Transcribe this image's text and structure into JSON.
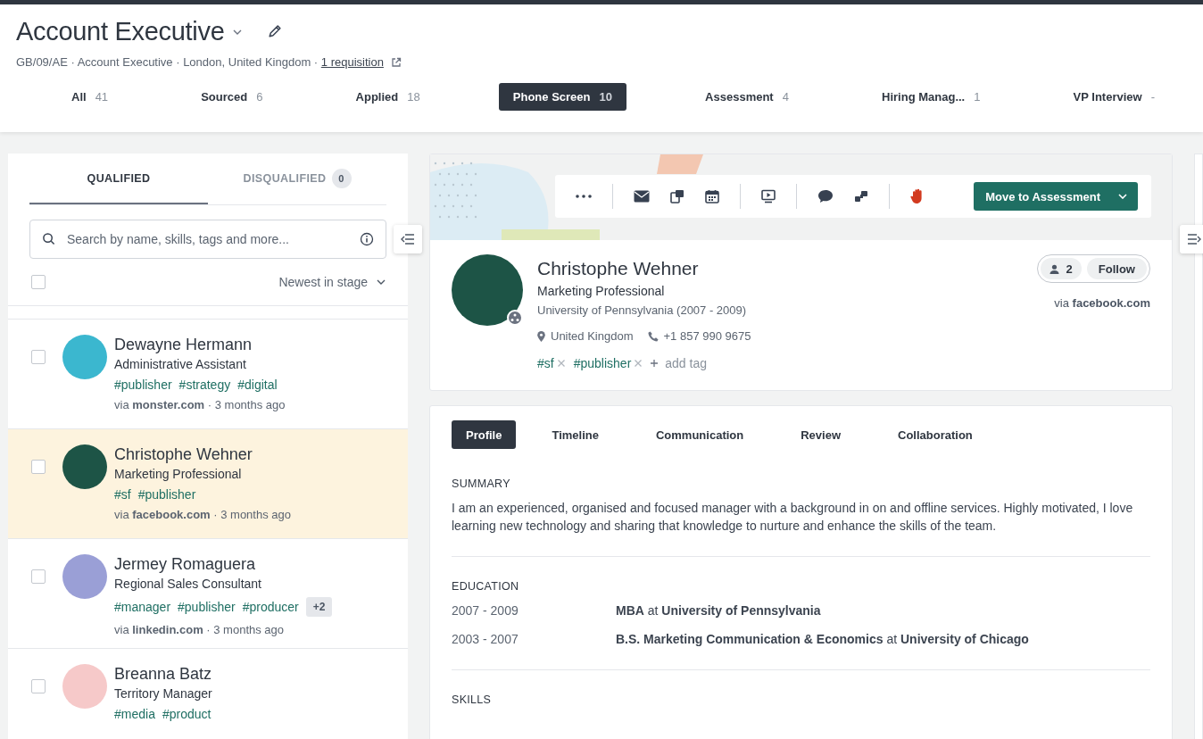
{
  "job": {
    "title": "Account Executive",
    "meta": "GB/09/AE · Account Executive · London, United Kingdom ·",
    "requisition_link": "1 requisition"
  },
  "stages": [
    {
      "label": "All",
      "count": "41",
      "selected": false
    },
    {
      "label": "Sourced",
      "count": "6",
      "selected": false
    },
    {
      "label": "Applied",
      "count": "18",
      "selected": false
    },
    {
      "label": "Phone Screen",
      "count": "10",
      "selected": true
    },
    {
      "label": "Assessment",
      "count": "4",
      "selected": false
    },
    {
      "label": "Hiring Manag...",
      "count": "1",
      "selected": false
    },
    {
      "label": "VP Interview",
      "count": "-",
      "selected": false
    }
  ],
  "candidate_list": {
    "tabs": [
      {
        "label": "QUALIFIED",
        "selected": true
      },
      {
        "label": "DISQUALIFIED",
        "count": "0",
        "selected": false
      }
    ],
    "search": {
      "placeholder": "Search by name, skills, tags and more..."
    },
    "select_all": {
      "checked": false
    },
    "sort": "Newest in stage",
    "candidates": [
      {
        "name": "Dewayne Hermann",
        "title": "Administrative Assistant",
        "tags": [
          "#publisher",
          "#strategy",
          "#digital"
        ],
        "source": "via **monster.com** · 3 months ago",
        "checked": false,
        "selected": false,
        "color": "#3bb7cf"
      },
      {
        "name": "Christophe Wehner",
        "title": "Marketing Professional",
        "tags": [
          "#sf",
          "#publisher"
        ],
        "source": "via **facebook.com** · 3 months ago",
        "checked": false,
        "selected": true,
        "color": "#1d5446"
      },
      {
        "name": "Jermey Romaguera",
        "title": "Regional Sales Consultant",
        "tags": [
          "#manager",
          "#publisher",
          "#producer"
        ],
        "more_tags": "+2",
        "source": "via **linkedin.com** · 3 months ago",
        "checked": false,
        "selected": false,
        "color": "#9a9fd6"
      },
      {
        "name": "Breanna Batz",
        "title": "Territory Manager",
        "tags": [
          "#media",
          "#product"
        ],
        "checked": false,
        "selected": false,
        "color": "#f6c9c9"
      }
    ]
  },
  "profile": {
    "primary_action": "Move to Assessment",
    "name": "Christophe Wehner",
    "headline": "Marketing Professional",
    "education": "University of Pennsylvania (2007 - 2009)",
    "location": "United Kingdom",
    "phone": "+1 857 990 9675",
    "tags": [
      "#sf",
      "#publisher"
    ],
    "add_tag": "add tag",
    "followers": "2",
    "follow": "Follow",
    "source": "via **facebook.com**"
  },
  "detail": {
    "tabs": [
      {
        "label": "Profile",
        "selected": true
      },
      {
        "label": "Timeline",
        "selected": false
      },
      {
        "label": "Communication",
        "selected": false
      },
      {
        "label": "Review",
        "selected": false
      },
      {
        "label": "Collaboration",
        "selected": false
      }
    ],
    "summary": {
      "heading": "SUMMARY",
      "text": "I am an experienced, organised and focused manager with a background in on and offline services. Highly motivated, I love learning new technology and sharing that knowledge to nurture and enhance the skills of the team."
    },
    "education": {
      "heading": "EDUCATION",
      "rows": [
        {
          "years": "2007 - 2009",
          "degree": "**MBA** at **University of Pennsylvania**"
        },
        {
          "years": "2003 - 2007",
          "degree": "**B.S. Marketing Communication & Economics** at **University of Chicago**"
        }
      ]
    },
    "skills": {
      "heading": "SKILLS"
    }
  }
}
